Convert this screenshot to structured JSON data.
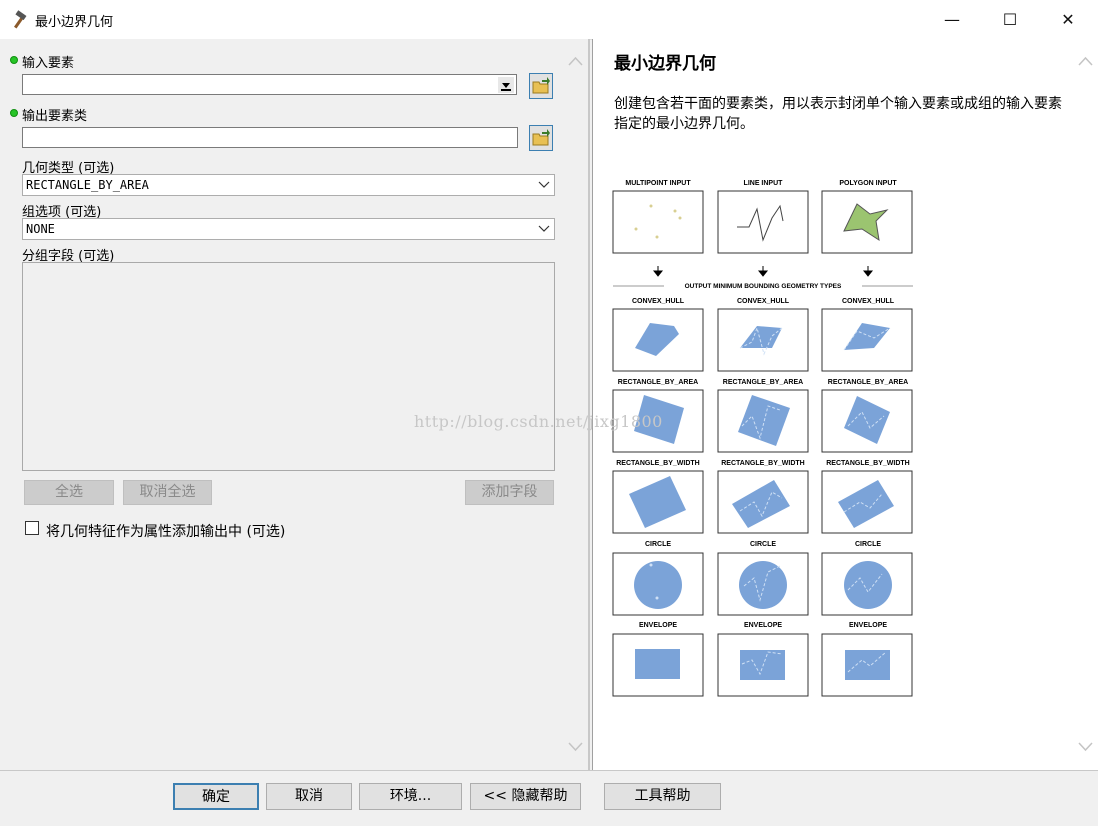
{
  "window": {
    "title": "最小边界几何",
    "controls": [
      "—",
      "☐",
      "✕"
    ]
  },
  "form": {
    "input_features_label": "输入要素",
    "input_features_value": "",
    "output_class_label": "输出要素类",
    "output_class_value": "",
    "geometry_type_label": "几何类型 (可选)",
    "geometry_type_value": "RECTANGLE_BY_AREA",
    "group_option_label": "组选项 (可选)",
    "group_option_value": "NONE",
    "group_field_label": "分组字段 (可选)",
    "select_all": "全选",
    "unselect_all": "取消全选",
    "add_field": "添加字段",
    "mbg_fields_label": "将几何特征作为属性添加输出中 (可选)",
    "mbg_fields_checked": false
  },
  "help": {
    "title": "最小边界几何",
    "description": "创建包含若干面的要素类，用以表示封闭单个输入要素或成组的输入要素指定的最小边界几何。",
    "diagram": {
      "inputs": [
        "MULTIPOINT INPUT",
        "LINE INPUT",
        "POLYGON INPUT"
      ],
      "separator": "OUTPUT MINIMUM BOUNDING GEOMETRY TYPES",
      "rows": [
        "CONVEX_HULL",
        "RECTANGLE_BY_AREA",
        "RECTANGLE_BY_WIDTH",
        "CIRCLE",
        "ENVELOPE"
      ],
      "fill_color": "#7ba3d8"
    }
  },
  "watermark": "http://blog.csdn.net/jixg1800",
  "footer": {
    "ok": "确定",
    "cancel": "取消",
    "environments": "环境...",
    "hide_help": "<< 隐藏帮助",
    "tool_help": "工具帮助"
  }
}
